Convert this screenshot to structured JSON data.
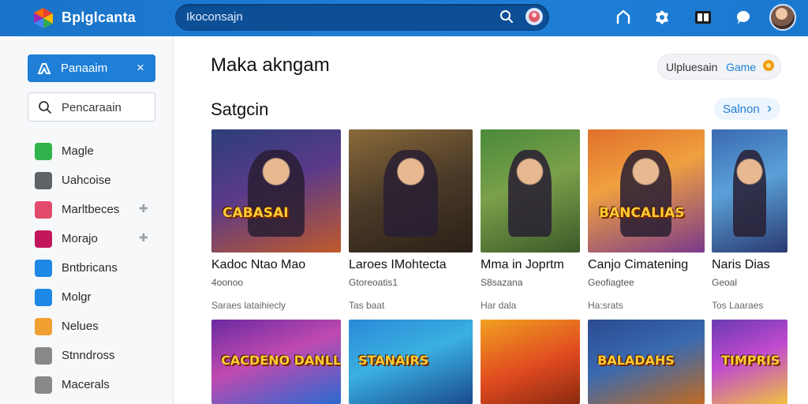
{
  "app": {
    "brand": "Bplglcanta",
    "search_value": "Ikoconsajn"
  },
  "sidebar": {
    "active": {
      "label": "Panaaim",
      "close": "×"
    },
    "search": {
      "placeholder": "Pencaraain"
    },
    "items": [
      {
        "label": "Magle",
        "icon": "chat-icon",
        "color": "#2fb34a",
        "pinned": false
      },
      {
        "label": "Uahcoise",
        "icon": "box-icon",
        "color": "#5f6368",
        "pinned": false
      },
      {
        "label": "Marltbeces",
        "icon": "puzzle-icon",
        "color": "#e24a6b",
        "pinned": true
      },
      {
        "label": "Morajo",
        "icon": "cube-icon",
        "color": "#c2185b",
        "pinned": true
      },
      {
        "label": "Bntbricans",
        "icon": "mail-icon",
        "color": "#1e88e5",
        "pinned": false
      },
      {
        "label": "Molgr",
        "icon": "circle-icon",
        "color": "#1e88e5",
        "pinned": false
      },
      {
        "label": "Nelues",
        "icon": "tile-icon",
        "color": "#f0a030",
        "pinned": false
      },
      {
        "label": "Stnndross",
        "icon": "disc-icon",
        "color": "#888888",
        "pinned": false
      },
      {
        "label": "Macerals",
        "icon": "grid-icon",
        "color": "#888888",
        "pinned": false
      }
    ]
  },
  "main": {
    "title": "Maka akngam",
    "upload": {
      "label": "Ulpluesain",
      "accent": "Game"
    },
    "section_title": "Satgcin",
    "see_all": "Salnon",
    "cards_row1": [
      {
        "title": "Kadoc Ntao Mao",
        "sub": "4oonoo",
        "meta": "Saraes lataihiecly",
        "art": "CABASAI"
      },
      {
        "title": "Laroes IMohtecta",
        "sub": "Gtoreoatis1",
        "meta": "Tas baat",
        "art": ""
      },
      {
        "title": "Mma in Joprtm",
        "sub": "S8sazana",
        "meta": "Har dala",
        "art": ""
      },
      {
        "title": "Canjo Cimatening",
        "sub": "Geofiagtee",
        "meta": "Ha:srats",
        "art": "BANCALIAS"
      },
      {
        "title": "Naris Dias",
        "sub": "Geoal",
        "meta": "Tos Laaraes",
        "art": ""
      }
    ],
    "cards_row2": [
      {
        "art": "CACDENO DANLLAS"
      },
      {
        "art": "STANAIRS"
      },
      {
        "art": ""
      },
      {
        "art": "BALADAHS"
      },
      {
        "art": "TIMPRIS"
      }
    ]
  }
}
